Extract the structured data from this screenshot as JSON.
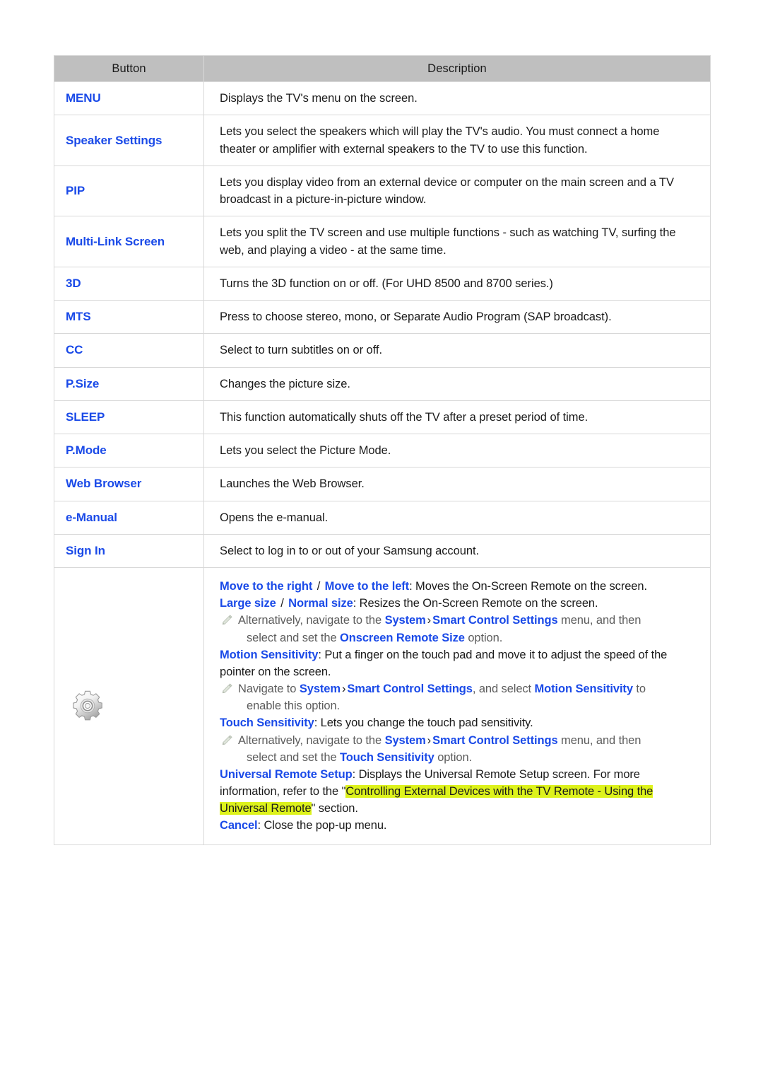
{
  "table": {
    "headers": {
      "button": "Button",
      "description": "Description"
    },
    "rows": [
      {
        "button": "MENU",
        "desc": [
          "Displays the TV's menu on the screen."
        ]
      },
      {
        "button": "Speaker Settings",
        "desc": [
          "Lets you select the speakers which will play the TV's audio. You must connect a home theater or amplifier with external speakers to the TV to use this function."
        ]
      },
      {
        "button": "PIP",
        "desc": [
          "Lets you display video from an external device or computer on the main screen and a TV broadcast in a picture-in-picture window."
        ]
      },
      {
        "button": "Multi-Link Screen",
        "desc": [
          "Lets you split the TV screen and use multiple functions - such as watching TV, surfing the web, and playing a video - at the same time."
        ]
      },
      {
        "button": "3D",
        "desc": [
          "Turns the 3D function on or off. (For UHD 8500 and 8700 series.)"
        ]
      },
      {
        "button": "MTS",
        "desc": [
          "Press to choose stereo, mono, or Separate Audio Program (SAP broadcast)."
        ]
      },
      {
        "button": "CC",
        "desc": [
          "Select to turn subtitles on or off."
        ]
      },
      {
        "button": "P.Size",
        "desc": [
          "Changes the picture size."
        ]
      },
      {
        "button": "SLEEP",
        "desc": [
          "This function automatically shuts off the TV after a preset period of time."
        ]
      },
      {
        "button": "P.Mode",
        "desc": [
          "Lets you select the Picture Mode."
        ]
      },
      {
        "button": "Web Browser",
        "desc": [
          "Launches the Web Browser."
        ]
      },
      {
        "button": "e-Manual",
        "desc": [
          "Opens the e-manual."
        ]
      },
      {
        "button": "Sign In",
        "desc": [
          "Select to log in to or out of your Samsung account."
        ]
      }
    ]
  },
  "gear_row": {
    "icon": "gear-icon",
    "blocks": {
      "move_right": "Move to the right",
      "slash1": " / ",
      "move_left": "Move to the left",
      "move_rest": ": Moves the On-Screen Remote on the screen.",
      "large_size": "Large size",
      "slash2": " / ",
      "normal_size": "Normal size",
      "size_rest": ": Resizes the On-Screen Remote on the screen.",
      "note1_a": "Alternatively, navigate to the ",
      "note1_system": "System",
      "note1_gt": "›",
      "note1_scs": "Smart Control Settings",
      "note1_b": " menu, and then",
      "note1_c": "select and set the ",
      "note1_option": "Onscreen Remote Size",
      "note1_d": " option.",
      "motion_sens": "Motion Sensitivity",
      "motion_rest": ": Put a finger on the touch pad and move it to adjust the speed of the pointer on the screen.",
      "note2_a": "Navigate to ",
      "note2_system": "System",
      "note2_gt": "›",
      "note2_scs": "Smart Control Settings",
      "note2_b": ", and select ",
      "note2_ms": "Motion Sensitivity",
      "note2_c": " to",
      "note2_d": "enable this option.",
      "touch_sens": "Touch Sensitivity",
      "touch_rest": ": Lets you change the touch pad sensitivity.",
      "note3_a": "Alternatively, navigate to the ",
      "note3_system": "System",
      "note3_gt": "›",
      "note3_scs": "Smart Control Settings",
      "note3_b": " menu, and then",
      "note3_c": "select and set the ",
      "note3_option": "Touch Sensitivity",
      "note3_d": " option.",
      "urs": "Universal Remote Setup",
      "urs_rest1": ": Displays the Universal Remote Setup screen. For more information, refer to the \"",
      "urs_link": "Controlling External Devices with the TV Remote - Using the Universal Remote",
      "urs_rest2": "\" section.",
      "cancel": "Cancel",
      "cancel_rest": ": Close the pop-up menu."
    }
  },
  "colors": {
    "accent_blue": "#1a4ae8",
    "header_gray": "#bfbfbf",
    "highlight_yellow": "#ddf21c",
    "note_gray": "#5c5c5c",
    "border_gray": "#d8d8d8",
    "text_black": "#1a1a1a"
  }
}
